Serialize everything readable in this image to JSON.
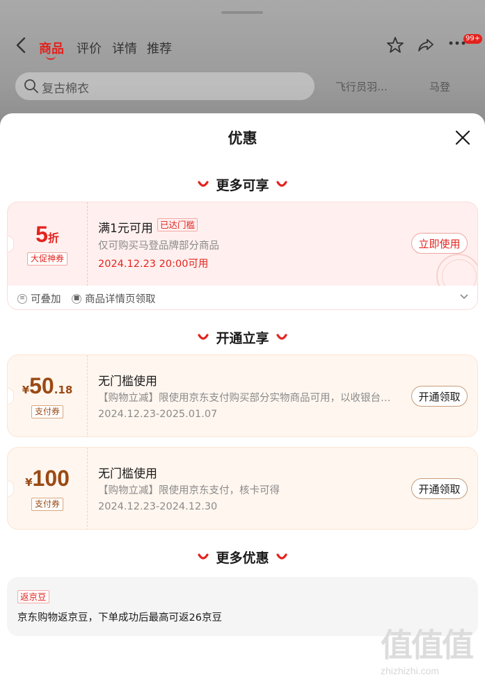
{
  "background": {
    "tabs": [
      "商品",
      "评价",
      "详情",
      "推荐"
    ],
    "active_tab": "商品",
    "badge": "99+",
    "search_placeholder": "复古棉衣",
    "chips": [
      "飞行员羽…",
      "马登"
    ]
  },
  "sheet": {
    "title": "优惠",
    "sections": [
      "更多可享",
      "开通立享",
      "更多优惠"
    ]
  },
  "coupons": [
    {
      "amount": "5",
      "unit": "折",
      "tag": "大促神券",
      "title": "满1元可用",
      "badge": "已达门槛",
      "desc": "仅可购买马登品牌部分商品",
      "date": "2024.12.23 20:00可用",
      "button": "立即使用",
      "footer": [
        "可叠加",
        "商品详情页领取"
      ]
    },
    {
      "currency": "¥",
      "amount": "50",
      "decimal": ".18",
      "tag": "支付券",
      "title": "无门槛使用",
      "desc": "【购物立减】限使用京东支付购买部分实物商品可用，以收银台…",
      "date": "2024.12.23-2025.01.07",
      "button": "开通领取"
    },
    {
      "currency": "¥",
      "amount": "100",
      "tag": "支付券",
      "title": "无门槛使用",
      "desc": "【购物立减】限使用京东支付，核卡可得",
      "date": "2024.12.23-2024.12.30",
      "button": "开通领取"
    }
  ],
  "rebate": {
    "tag": "返京豆",
    "text": "京东购物返京豆，下单成功后最高可返26京豆"
  },
  "watermark": {
    "big": "值值值",
    "small": "zhizhizhi.com"
  },
  "colors": {
    "accent": "#e3231e",
    "brown": "#9a4a14"
  }
}
